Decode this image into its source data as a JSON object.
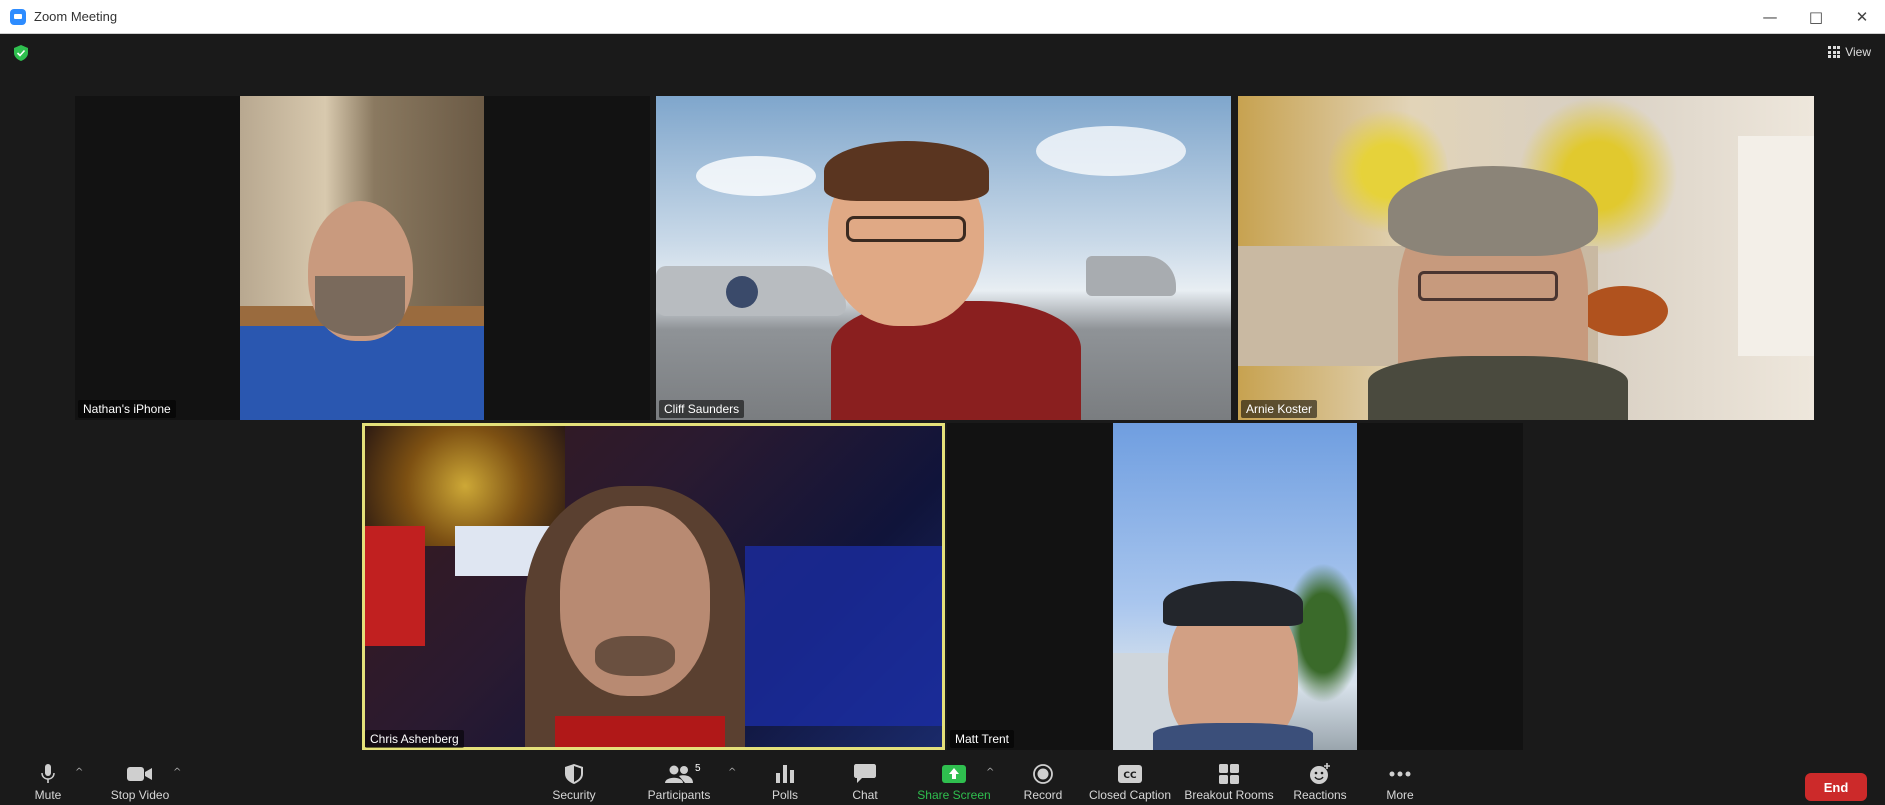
{
  "window": {
    "title": "Zoom Meeting",
    "controls": [
      "minimize-icon",
      "maximize-icon",
      "close-icon"
    ]
  },
  "meeting": {
    "view_label": "View",
    "encrypted_icon": "shield-check-icon"
  },
  "participants": [
    {
      "name": "Nathan's iPhone",
      "scene": "indoor-curtain"
    },
    {
      "name": "Cliff Saunders",
      "scene": "aircraft-carrier-deck"
    },
    {
      "name": "Arnie Koster",
      "scene": "dining-room"
    },
    {
      "name": "Chris Ashenberg",
      "scene": "bar-neon",
      "active_speaker": true
    },
    {
      "name": "Matt Trent",
      "scene": "outdoor-sky-palm"
    }
  ],
  "toolbar": {
    "mute": "Mute",
    "stop_video": "Stop Video",
    "security": "Security",
    "participants": "Participants",
    "participants_count": "5",
    "polls": "Polls",
    "chat": "Chat",
    "share_screen": "Share Screen",
    "record": "Record",
    "closed_caption": "Closed Caption",
    "breakout_rooms": "Breakout Rooms",
    "reactions": "Reactions",
    "more": "More",
    "end": "End"
  },
  "colors": {
    "share_screen_accent": "#2fbf4f",
    "end_button": "#cc2a2a",
    "active_speaker_border": "#e4e07a",
    "background": "#1a1a1a"
  }
}
